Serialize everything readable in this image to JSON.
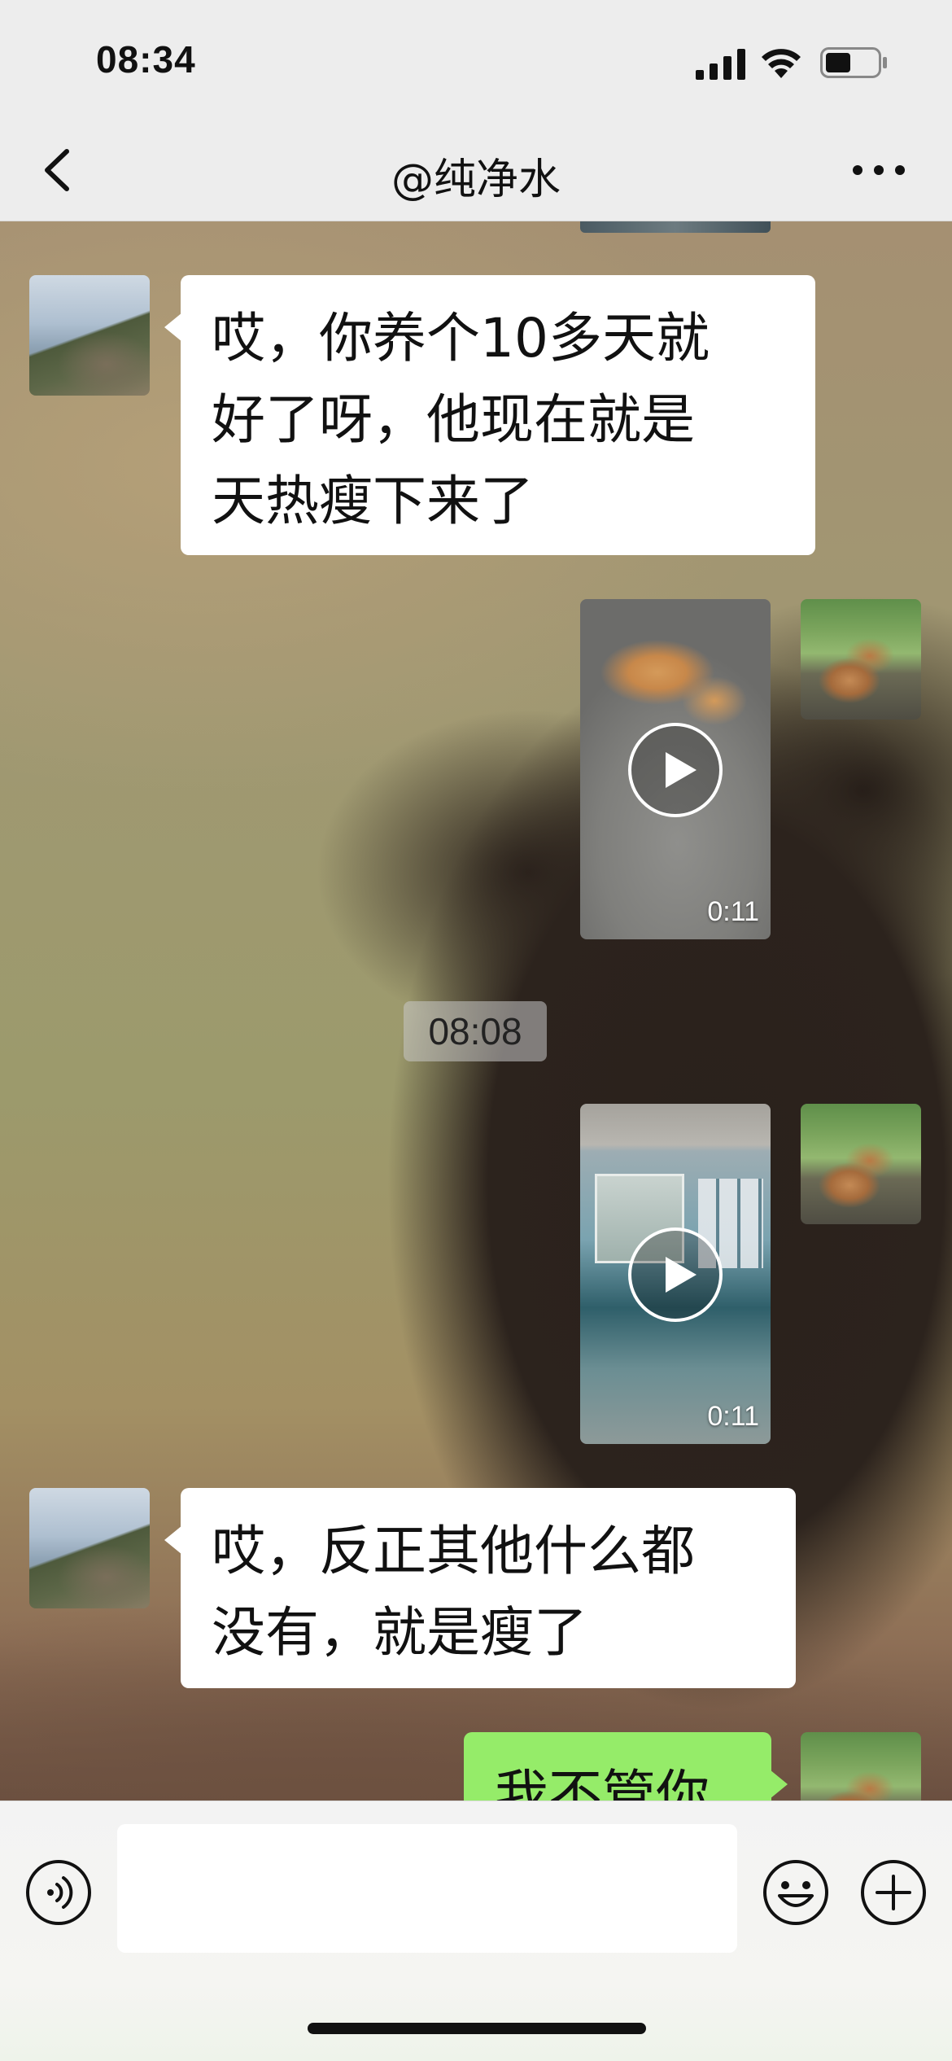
{
  "status_bar": {
    "time": "08:34",
    "icons": [
      "signal-icon",
      "wifi-icon",
      "battery-icon"
    ]
  },
  "nav": {
    "back_icon": "chevron-left-icon",
    "title": "@纯净水",
    "more_icon": "more-dots-icon"
  },
  "chat": {
    "messages": [
      {
        "side": "left",
        "type": "text",
        "avatar": "mountain-avatar",
        "text": "哎，你养个10多天就\n好了呀，他现在就是\n天热瘦下来了"
      },
      {
        "side": "right",
        "type": "video",
        "avatar": "dog-avatar",
        "duration": "0:11"
      },
      {
        "type": "timestamp",
        "text": "08:08"
      },
      {
        "side": "right",
        "type": "video",
        "avatar": "dog-avatar",
        "duration": "0:11"
      },
      {
        "side": "left",
        "type": "text",
        "avatar": "mountain-avatar",
        "text": "哎，反正其他什么都\n没有，就是瘦了"
      },
      {
        "side": "right",
        "type": "text",
        "avatar": "dog-avatar",
        "text": "我不管你"
      }
    ]
  },
  "input_bar": {
    "voice_icon": "voice-icon",
    "input_value": "",
    "emoji_icon": "emoji-icon",
    "plus_icon": "plus-icon"
  },
  "colors": {
    "bubble_left": "#ffffff",
    "bubble_right": "#95ec69",
    "bar_background": "#ededed"
  }
}
